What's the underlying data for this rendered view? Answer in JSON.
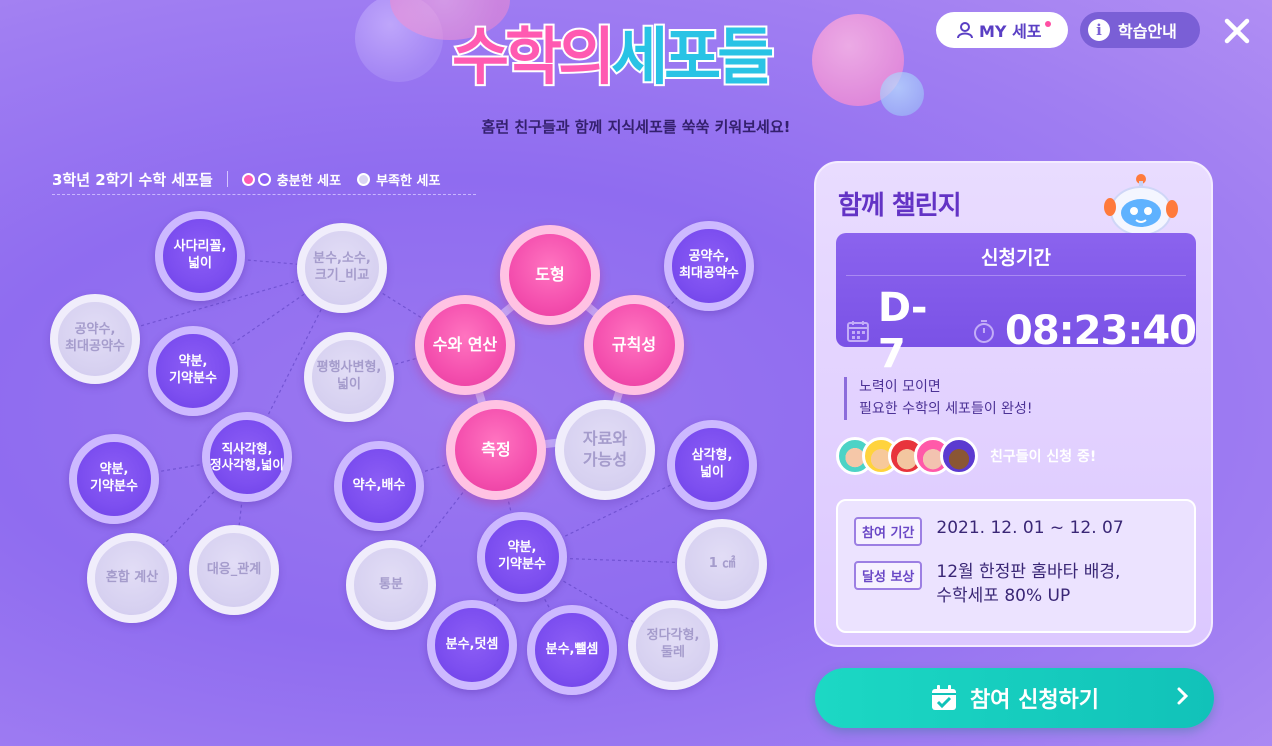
{
  "header": {
    "logo": {
      "part1": "수학의",
      "part2": "세포들"
    },
    "subtitle": "홈런 친구들과 함께 지식세포를 쑥쑥 키워보세요!",
    "my_cell_label": "MY 세포",
    "guide_label": "학습안내"
  },
  "legend": {
    "title": "3학년 2학기 수학 세포들",
    "sufficient": "충분한 세포",
    "insufficient": "부족한 세포"
  },
  "nodes": [
    {
      "label": "도형",
      "status": "sufficient"
    },
    {
      "label": "수와 연산",
      "status": "sufficient"
    },
    {
      "label": "규칙성",
      "status": "sufficient"
    },
    {
      "label": "측정",
      "status": "sufficient"
    },
    {
      "label": "자료와\n가능성",
      "status": "insufficient"
    },
    {
      "label": "사다리꼴,\n넓이",
      "status": "active"
    },
    {
      "label": "분수,소수,\n크기_비교",
      "status": "insufficient"
    },
    {
      "label": "공약수,\n최대공약수",
      "status": "insufficient"
    },
    {
      "label": "약분,\n기약분수",
      "status": "active"
    },
    {
      "label": "평행사변형,\n넓이",
      "status": "insufficient"
    },
    {
      "label": "직사각형,\n정사각형,넓이",
      "status": "active"
    },
    {
      "label": "약분,\n기약분수",
      "status": "active"
    },
    {
      "label": "혼합 계산",
      "status": "insufficient"
    },
    {
      "label": "대응_관계",
      "status": "insufficient"
    },
    {
      "label": "약수,배수",
      "status": "active"
    },
    {
      "label": "통분",
      "status": "insufficient"
    },
    {
      "label": "공약수,\n최대공약수",
      "status": "active"
    },
    {
      "label": "삼각형,\n넓이",
      "status": "active"
    },
    {
      "label": "약분,\n기약분수",
      "status": "active"
    },
    {
      "label": "1 ㎠",
      "status": "insufficient"
    },
    {
      "label": "분수,덧셈",
      "status": "active"
    },
    {
      "label": "분수,뺄셈",
      "status": "active"
    },
    {
      "label": "정다각형,\n둘레",
      "status": "insufficient"
    }
  ],
  "challenge": {
    "title": "함께 챌린지",
    "period_label": "신청기간",
    "d_day": "D-7",
    "timer": "08:23:40",
    "notice_line1": "노력이 모이면",
    "notice_line2": "필요한 수학의 세포들이 완성!",
    "friends_text": "친구들이 신청 중!",
    "period_tag": "참여 기간",
    "period_value": "2021. 12. 01 ~ 12. 07",
    "reward_tag": "달성 보상",
    "reward_line1": "12월 한정판 홈바타 배경,",
    "reward_line2": "수학세포 80% UP",
    "cta_label": "참여 신청하기"
  },
  "colors": {
    "background": "#9274f0",
    "sufficient": "#f44fae",
    "active": "#7d4ff0",
    "insufficient": "#d6d0f0",
    "cta": "#1cd8c4",
    "panel": "#e3d3ff"
  }
}
